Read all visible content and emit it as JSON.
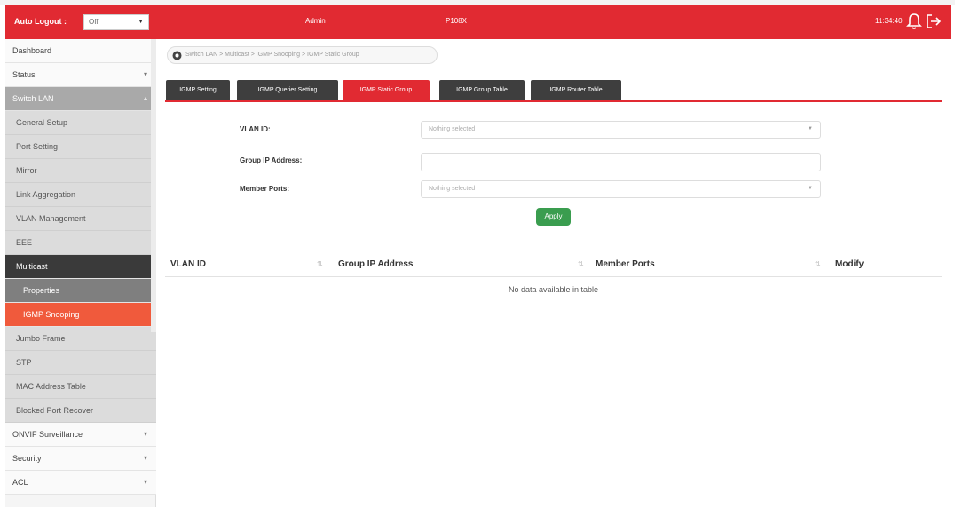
{
  "header": {
    "auto_logout_label": "Auto Logout :",
    "auto_logout_value": "Off",
    "user": "Admin",
    "model": "P108X",
    "time": "11:34:40",
    "accent_color": "#e12a32"
  },
  "sidebar": {
    "items": [
      {
        "label": "Dashboard"
      },
      {
        "label": "Status"
      },
      {
        "label": "Switch LAN"
      },
      {
        "label": "General Setup"
      },
      {
        "label": "Port Setting"
      },
      {
        "label": "Mirror"
      },
      {
        "label": "Link Aggregation"
      },
      {
        "label": "VLAN Management"
      },
      {
        "label": "EEE"
      },
      {
        "label": "Multicast"
      },
      {
        "label": "Properties"
      },
      {
        "label": "IGMP Snooping"
      },
      {
        "label": "Jumbo Frame"
      },
      {
        "label": "STP"
      },
      {
        "label": "MAC Address Table"
      },
      {
        "label": "Blocked Port Recover"
      },
      {
        "label": "ONVIF Surveillance"
      },
      {
        "label": "Security"
      },
      {
        "label": "ACL"
      }
    ]
  },
  "breadcrumb": "Switch LAN > Multicast > IGMP Snooping > IGMP Static Group",
  "tabs": [
    {
      "label": "IGMP Setting"
    },
    {
      "label": "IGMP Querier Setting"
    },
    {
      "label": "IGMP Static Group"
    },
    {
      "label": "IGMP Group Table"
    },
    {
      "label": "IGMP Router Table"
    }
  ],
  "form": {
    "vlan_id_label": "VLAN ID:",
    "vlan_id_placeholder": "Nothing selected",
    "group_ip_label": "Group IP Address:",
    "group_ip_value": "",
    "member_ports_label": "Member Ports:",
    "member_ports_placeholder": "Nothing selected",
    "apply_label": "Apply"
  },
  "table": {
    "columns": [
      "VLAN ID",
      "Group IP Address",
      "Member Ports",
      "Modify"
    ],
    "empty_text": "No data available in table"
  }
}
